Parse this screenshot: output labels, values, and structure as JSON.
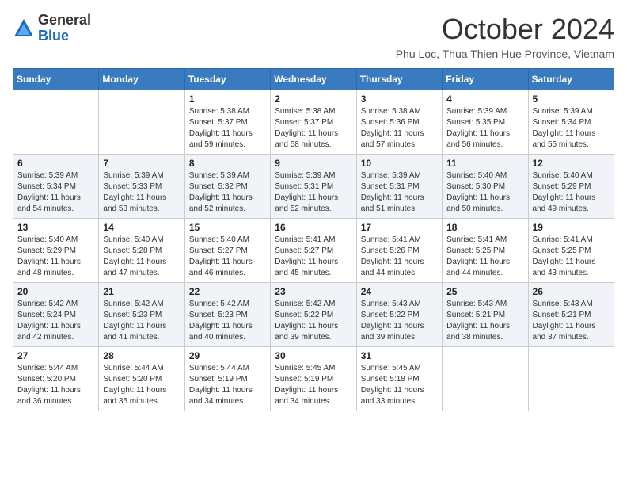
{
  "logo": {
    "general": "General",
    "blue": "Blue"
  },
  "title": "October 2024",
  "location": "Phu Loc, Thua Thien Hue Province, Vietnam",
  "days_of_week": [
    "Sunday",
    "Monday",
    "Tuesday",
    "Wednesday",
    "Thursday",
    "Friday",
    "Saturday"
  ],
  "weeks": [
    [
      {
        "day": "",
        "info": ""
      },
      {
        "day": "",
        "info": ""
      },
      {
        "day": "1",
        "info": "Sunrise: 5:38 AM\nSunset: 5:37 PM\nDaylight: 11 hours and 59 minutes."
      },
      {
        "day": "2",
        "info": "Sunrise: 5:38 AM\nSunset: 5:37 PM\nDaylight: 11 hours and 58 minutes."
      },
      {
        "day": "3",
        "info": "Sunrise: 5:38 AM\nSunset: 5:36 PM\nDaylight: 11 hours and 57 minutes."
      },
      {
        "day": "4",
        "info": "Sunrise: 5:39 AM\nSunset: 5:35 PM\nDaylight: 11 hours and 56 minutes."
      },
      {
        "day": "5",
        "info": "Sunrise: 5:39 AM\nSunset: 5:34 PM\nDaylight: 11 hours and 55 minutes."
      }
    ],
    [
      {
        "day": "6",
        "info": "Sunrise: 5:39 AM\nSunset: 5:34 PM\nDaylight: 11 hours and 54 minutes."
      },
      {
        "day": "7",
        "info": "Sunrise: 5:39 AM\nSunset: 5:33 PM\nDaylight: 11 hours and 53 minutes."
      },
      {
        "day": "8",
        "info": "Sunrise: 5:39 AM\nSunset: 5:32 PM\nDaylight: 11 hours and 52 minutes."
      },
      {
        "day": "9",
        "info": "Sunrise: 5:39 AM\nSunset: 5:31 PM\nDaylight: 11 hours and 52 minutes."
      },
      {
        "day": "10",
        "info": "Sunrise: 5:39 AM\nSunset: 5:31 PM\nDaylight: 11 hours and 51 minutes."
      },
      {
        "day": "11",
        "info": "Sunrise: 5:40 AM\nSunset: 5:30 PM\nDaylight: 11 hours and 50 minutes."
      },
      {
        "day": "12",
        "info": "Sunrise: 5:40 AM\nSunset: 5:29 PM\nDaylight: 11 hours and 49 minutes."
      }
    ],
    [
      {
        "day": "13",
        "info": "Sunrise: 5:40 AM\nSunset: 5:29 PM\nDaylight: 11 hours and 48 minutes."
      },
      {
        "day": "14",
        "info": "Sunrise: 5:40 AM\nSunset: 5:28 PM\nDaylight: 11 hours and 47 minutes."
      },
      {
        "day": "15",
        "info": "Sunrise: 5:40 AM\nSunset: 5:27 PM\nDaylight: 11 hours and 46 minutes."
      },
      {
        "day": "16",
        "info": "Sunrise: 5:41 AM\nSunset: 5:27 PM\nDaylight: 11 hours and 45 minutes."
      },
      {
        "day": "17",
        "info": "Sunrise: 5:41 AM\nSunset: 5:26 PM\nDaylight: 11 hours and 44 minutes."
      },
      {
        "day": "18",
        "info": "Sunrise: 5:41 AM\nSunset: 5:25 PM\nDaylight: 11 hours and 44 minutes."
      },
      {
        "day": "19",
        "info": "Sunrise: 5:41 AM\nSunset: 5:25 PM\nDaylight: 11 hours and 43 minutes."
      }
    ],
    [
      {
        "day": "20",
        "info": "Sunrise: 5:42 AM\nSunset: 5:24 PM\nDaylight: 11 hours and 42 minutes."
      },
      {
        "day": "21",
        "info": "Sunrise: 5:42 AM\nSunset: 5:23 PM\nDaylight: 11 hours and 41 minutes."
      },
      {
        "day": "22",
        "info": "Sunrise: 5:42 AM\nSunset: 5:23 PM\nDaylight: 11 hours and 40 minutes."
      },
      {
        "day": "23",
        "info": "Sunrise: 5:42 AM\nSunset: 5:22 PM\nDaylight: 11 hours and 39 minutes."
      },
      {
        "day": "24",
        "info": "Sunrise: 5:43 AM\nSunset: 5:22 PM\nDaylight: 11 hours and 39 minutes."
      },
      {
        "day": "25",
        "info": "Sunrise: 5:43 AM\nSunset: 5:21 PM\nDaylight: 11 hours and 38 minutes."
      },
      {
        "day": "26",
        "info": "Sunrise: 5:43 AM\nSunset: 5:21 PM\nDaylight: 11 hours and 37 minutes."
      }
    ],
    [
      {
        "day": "27",
        "info": "Sunrise: 5:44 AM\nSunset: 5:20 PM\nDaylight: 11 hours and 36 minutes."
      },
      {
        "day": "28",
        "info": "Sunrise: 5:44 AM\nSunset: 5:20 PM\nDaylight: 11 hours and 35 minutes."
      },
      {
        "day": "29",
        "info": "Sunrise: 5:44 AM\nSunset: 5:19 PM\nDaylight: 11 hours and 34 minutes."
      },
      {
        "day": "30",
        "info": "Sunrise: 5:45 AM\nSunset: 5:19 PM\nDaylight: 11 hours and 34 minutes."
      },
      {
        "day": "31",
        "info": "Sunrise: 5:45 AM\nSunset: 5:18 PM\nDaylight: 11 hours and 33 minutes."
      },
      {
        "day": "",
        "info": ""
      },
      {
        "day": "",
        "info": ""
      }
    ]
  ]
}
